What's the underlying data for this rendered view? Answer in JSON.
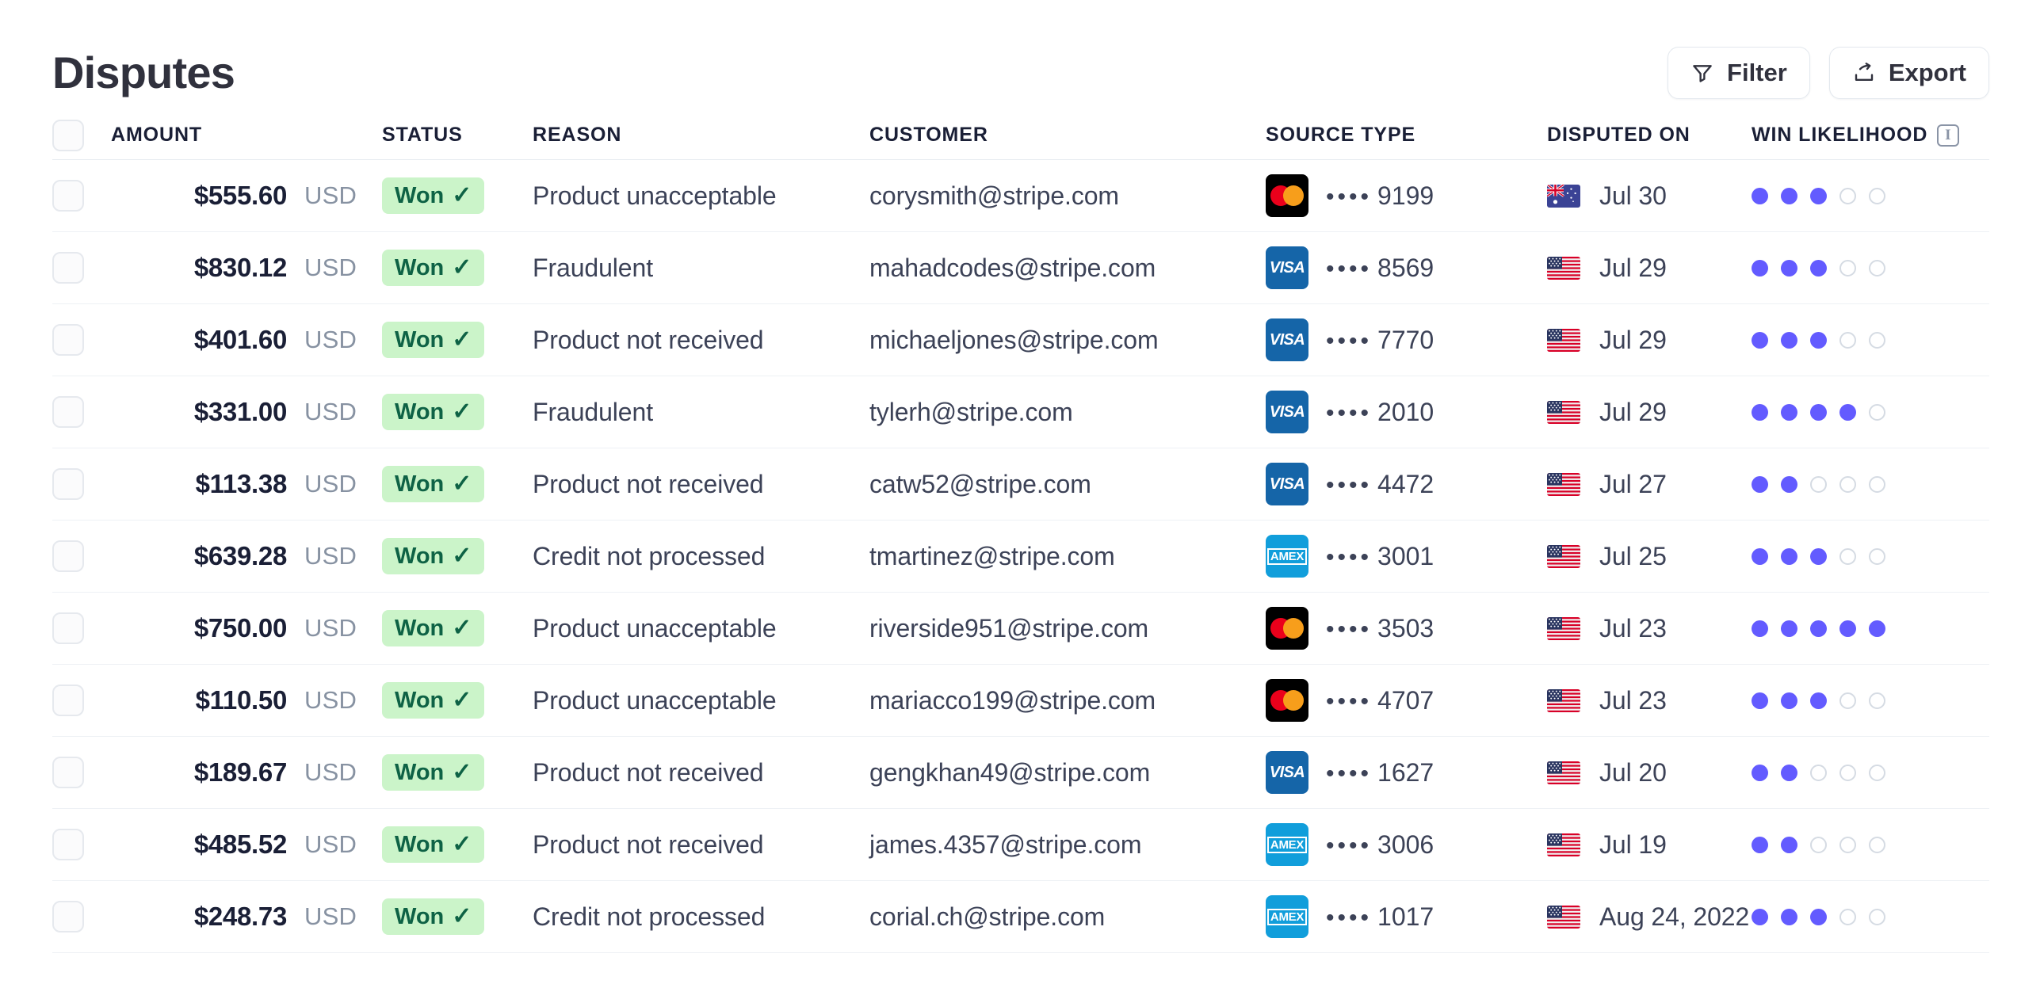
{
  "header": {
    "title": "Disputes",
    "filter_label": "Filter",
    "export_label": "Export"
  },
  "table": {
    "columns": {
      "amount": "AMOUNT",
      "status": "STATUS",
      "reason": "REASON",
      "customer": "CUSTOMER",
      "source_type": "SOURCE TYPE",
      "disputed_on": "DISPUTED ON",
      "win_likelihood": "WIN LIKELIHOOD"
    },
    "win_likelihood_max": 5,
    "rows": [
      {
        "amount": "$555.60",
        "currency": "USD",
        "status": "Won",
        "reason": "Product unacceptable",
        "customer": "corysmith@stripe.com",
        "brand": "mastercard",
        "last4": "9199",
        "country": "au",
        "disputed_on": "Jul 30",
        "win_likelihood": 3
      },
      {
        "amount": "$830.12",
        "currency": "USD",
        "status": "Won",
        "reason": "Fraudulent",
        "customer": "mahadcodes@stripe.com",
        "brand": "visa",
        "last4": "8569",
        "country": "us",
        "disputed_on": "Jul 29",
        "win_likelihood": 3
      },
      {
        "amount": "$401.60",
        "currency": "USD",
        "status": "Won",
        "reason": "Product not received",
        "customer": "michaeljones@stripe.com",
        "brand": "visa",
        "last4": "7770",
        "country": "us",
        "disputed_on": "Jul 29",
        "win_likelihood": 3
      },
      {
        "amount": "$331.00",
        "currency": "USD",
        "status": "Won",
        "reason": "Fraudulent",
        "customer": "tylerh@stripe.com",
        "brand": "visa",
        "last4": "2010",
        "country": "us",
        "disputed_on": "Jul 29",
        "win_likelihood": 4
      },
      {
        "amount": "$113.38",
        "currency": "USD",
        "status": "Won",
        "reason": "Product not received",
        "customer": "catw52@stripe.com",
        "brand": "visa",
        "last4": "4472",
        "country": "us",
        "disputed_on": "Jul 27",
        "win_likelihood": 2
      },
      {
        "amount": "$639.28",
        "currency": "USD",
        "status": "Won",
        "reason": "Credit not processed",
        "customer": "tmartinez@stripe.com",
        "brand": "amex",
        "last4": "3001",
        "country": "us",
        "disputed_on": "Jul 25",
        "win_likelihood": 3
      },
      {
        "amount": "$750.00",
        "currency": "USD",
        "status": "Won",
        "reason": "Product unacceptable",
        "customer": "riverside951@stripe.com",
        "brand": "mastercard",
        "last4": "3503",
        "country": "us",
        "disputed_on": "Jul 23",
        "win_likelihood": 5
      },
      {
        "amount": "$110.50",
        "currency": "USD",
        "status": "Won",
        "reason": "Product unacceptable",
        "customer": "mariacco199@stripe.com",
        "brand": "mastercard",
        "last4": "4707",
        "country": "us",
        "disputed_on": "Jul 23",
        "win_likelihood": 3
      },
      {
        "amount": "$189.67",
        "currency": "USD",
        "status": "Won",
        "reason": "Product not received",
        "customer": "gengkhan49@stripe.com",
        "brand": "visa",
        "last4": "1627",
        "country": "us",
        "disputed_on": "Jul 20",
        "win_likelihood": 2
      },
      {
        "amount": "$485.52",
        "currency": "USD",
        "status": "Won",
        "reason": "Product not received",
        "customer": "james.4357@stripe.com",
        "brand": "amex",
        "last4": "3006",
        "country": "us",
        "disputed_on": "Jul 19",
        "win_likelihood": 2
      },
      {
        "amount": "$248.73",
        "currency": "USD",
        "status": "Won",
        "reason": "Credit not processed",
        "customer": "corial.ch@stripe.com",
        "brand": "amex",
        "last4": "1017",
        "country": "us",
        "disputed_on": "Aug 24, 2022",
        "win_likelihood": 3
      }
    ]
  },
  "icons": {
    "filter": "filter-icon",
    "export": "export-icon",
    "info": "info-icon",
    "check": "check-icon",
    "mask_dots": "••••"
  },
  "colors": {
    "accent": "#635bff",
    "badge_bg": "#cbf4c9",
    "badge_fg": "#0e6245",
    "text": "#3c4257",
    "muted": "#8792a2"
  }
}
